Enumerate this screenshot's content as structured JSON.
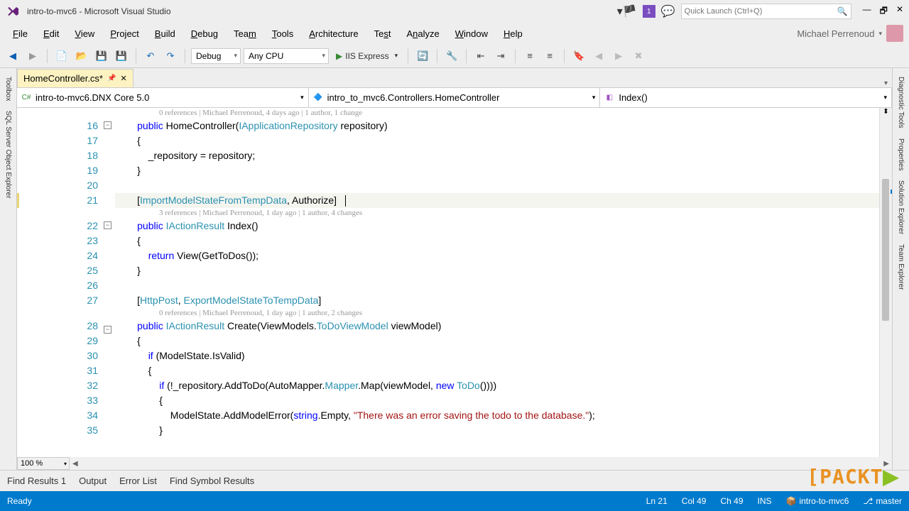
{
  "title": "intro-to-mvc6 - Microsoft Visual Studio",
  "notif_count": "1",
  "quick_launch_placeholder": "Quick Launch (Ctrl+Q)",
  "menu": [
    "File",
    "Edit",
    "View",
    "Project",
    "Build",
    "Debug",
    "Team",
    "Tools",
    "Architecture",
    "Test",
    "Analyze",
    "Window",
    "Help"
  ],
  "user": "Michael Perrenoud",
  "toolbar": {
    "config": "Debug",
    "platform": "Any CPU",
    "run": "IIS Express"
  },
  "tab_name": "HomeController.cs*",
  "nav": {
    "project": "intro-to-mvc6.DNX Core 5.0",
    "class": "intro_to_mvc6.Controllers.HomeController",
    "member": "Index()"
  },
  "codelens": {
    "l1": "0 references | Michael Perrenoud, 4 days ago | 1 author, 1 change",
    "l2": "3 references | Michael Perrenoud, 1 day ago | 1 author, 4 changes",
    "l3": "0 references | Michael Perrenoud, 1 day ago | 1 author, 2 changes"
  },
  "lines": {
    "16": {
      "no": "16"
    },
    "17": {
      "no": "17"
    },
    "18": {
      "no": "18"
    },
    "19": {
      "no": "19"
    },
    "20": {
      "no": "20"
    },
    "21": {
      "no": "21"
    },
    "22": {
      "no": "22"
    },
    "23": {
      "no": "23"
    },
    "24": {
      "no": "24"
    },
    "25": {
      "no": "25"
    },
    "26": {
      "no": "26"
    },
    "27": {
      "no": "27"
    },
    "28": {
      "no": "28"
    },
    "29": {
      "no": "29"
    },
    "30": {
      "no": "30"
    },
    "31": {
      "no": "31"
    },
    "32": {
      "no": "32"
    },
    "33": {
      "no": "33"
    },
    "34": {
      "no": "34"
    },
    "35": {
      "no": "35"
    }
  },
  "code": {
    "t16a": "        public HomeController(",
    "t16b": "IApplicationRepository",
    "t16c": " repository)",
    "t17": "        {",
    "t18": "            _repository = repository;",
    "t19": "        }",
    "t20": "",
    "t21a": "        [",
    "t21b": "ImportModelStateFromTempData",
    "t21c": ", Authorize]",
    "t22a": "        public ",
    "t22b": "IActionResult",
    "t22c": " Index()",
    "t23": "        {",
    "t24a": "            return View(GetToDos());",
    "t25": "        }",
    "t26": "",
    "t27a": "        [",
    "t27b": "HttpPost",
    "t27c": ", ",
    "t27d": "ExportModelStateToTempData",
    "t27e": "]",
    "t28a": "        public ",
    "t28b": "IActionResult",
    "t28c": " Create(ViewModels.",
    "t28d": "ToDoViewModel",
    "t28e": " viewModel)",
    "t29": "        {",
    "t30a": "            if (ModelState.IsValid)",
    "t31": "            {",
    "t32a": "                if (!_repository.AddToDo(AutoMapper.",
    "t32b": "Mapper",
    "t32c": ".Map(viewModel, ",
    "t32d": "new ",
    "t32e": "ToDo",
    "t32f": "())))",
    "t33": "                {",
    "t34a": "                    ModelState.AddModelError(",
    "t34b": "string",
    "t34c": ".Empty, ",
    "t34d": "\"There was an error saving the todo to the database.\"",
    "t34e": ");",
    "t35": "                }",
    "kw_public": "public",
    "kw_return": "return",
    "kw_if": "if",
    "kw_new": "new"
  },
  "zoom": "100 %",
  "bottom_tabs": [
    "Find Results 1",
    "Output",
    "Error List",
    "Find Symbol Results"
  ],
  "status": {
    "ready": "Ready",
    "ln": "Ln 21",
    "col": "Col 49",
    "ch": "Ch 49",
    "ins": "INS",
    "proj": "intro-to-mvc6",
    "branch": "master"
  },
  "side_left": [
    "Toolbox",
    "SQL Server Object Explorer"
  ],
  "side_right": [
    "Diagnostic Tools",
    "Properties",
    "Solution Explorer",
    "Team Explorer"
  ]
}
